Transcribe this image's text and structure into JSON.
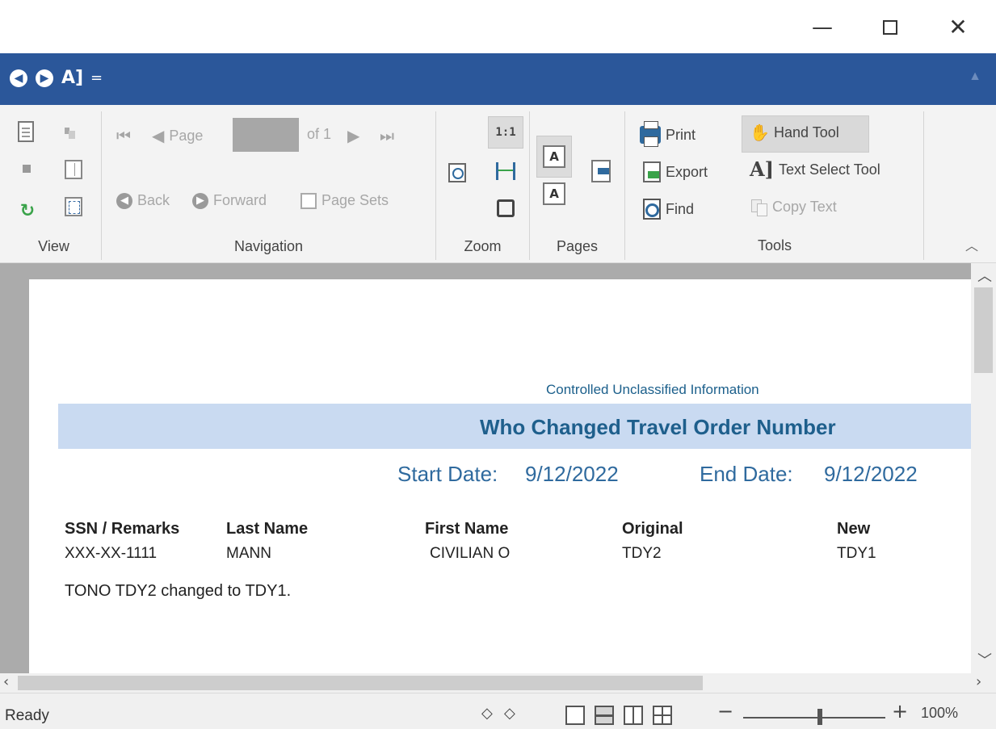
{
  "window": {
    "minimize_glyph": "—",
    "close_glyph": "✕"
  },
  "quick_access": {
    "back_icon": "arrow-left-circle-icon",
    "forward_icon": "arrow-right-circle-icon",
    "text_select_label": "A]",
    "customize_glyph": "="
  },
  "ribbon": {
    "groups": {
      "view": "View",
      "navigation": "Navigation",
      "zoom": "Zoom",
      "pages": "Pages",
      "tools": "Tools"
    },
    "navigation": {
      "page_label": "Page",
      "page_value": "",
      "of_label": "of 1",
      "back_label": "Back",
      "forward_label": "Forward",
      "page_sets_label": "Page Sets"
    },
    "zoom": {
      "actual_size_label": "1:1"
    },
    "pages": {
      "single_label": "A",
      "two_label": "A"
    },
    "tools": {
      "print_label": "Print",
      "export_label": "Export",
      "find_label": "Find",
      "hand_tool_label": "Hand Tool",
      "text_select_label": "Text Select Tool",
      "copy_text_label": "Copy Text"
    }
  },
  "report": {
    "classification": "Controlled Unclassified Information",
    "title": "Who Changed Travel Order Number",
    "start_date_label": "Start Date:",
    "start_date": "9/12/2022",
    "end_date_label": "End Date:",
    "end_date": "9/12/2022",
    "columns": [
      "SSN / Remarks",
      "Last Name",
      "First Name",
      "Original",
      "New"
    ],
    "rows": [
      {
        "ssn": "XXX-XX-1111",
        "last_name": "MANN",
        "first_name": "CIVILIAN O",
        "original": "TDY2",
        "new": "TDY1",
        "remarks": "TONO TDY2 changed to TDY1."
      }
    ]
  },
  "status": {
    "text": "Ready",
    "zoom_minus": "−",
    "zoom_plus": "+",
    "zoom_level": "100%"
  },
  "colors": {
    "titlebar_blue": "#2b579a",
    "report_band": "#c9daf1",
    "report_title": "#1e5f8c"
  }
}
